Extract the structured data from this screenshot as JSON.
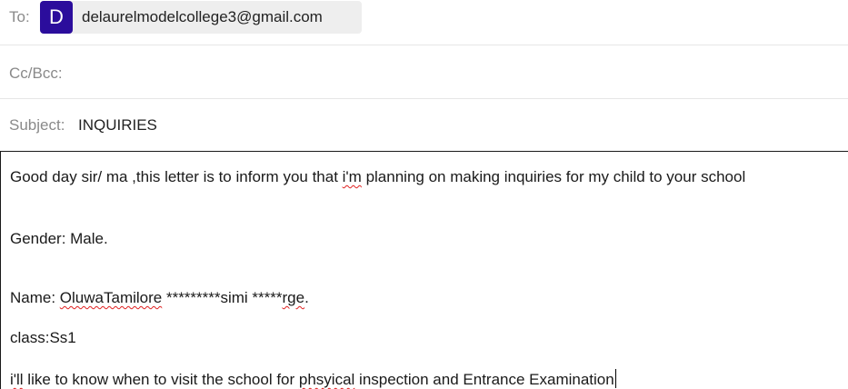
{
  "to": {
    "label": "To:",
    "recipient": {
      "avatar_letter": "D",
      "avatar_color": "#2b0d9c",
      "email": "delaurelmodelcollege3@gmail.com"
    }
  },
  "cc_bcc": {
    "label": "Cc/Bcc:"
  },
  "subject": {
    "label": "Subject:",
    "value": "INQUIRIES"
  },
  "body": {
    "line1": {
      "before": "Good day sir/ ma ,this letter is to inform you that ",
      "misspelled": "i'm",
      "after": " planning on making inquiries for my child to your school"
    },
    "line2": "Gender: Male.",
    "line3": {
      "before": "Name: ",
      "misspelled1": "OluwaTamilore",
      "middle": " *********simi *****",
      "misspelled2": "rge",
      "after": "."
    },
    "line4": "class:Ss1",
    "line5": {
      "misspelled1": "i'll",
      "middle": " like to know when to visit the school for ",
      "misspelled2": "phsyical",
      "after": " inspection and Entrance Examination"
    }
  },
  "colors": {
    "spellcheck_underline": "#e02020",
    "label_gray": "#8a8a8a"
  }
}
